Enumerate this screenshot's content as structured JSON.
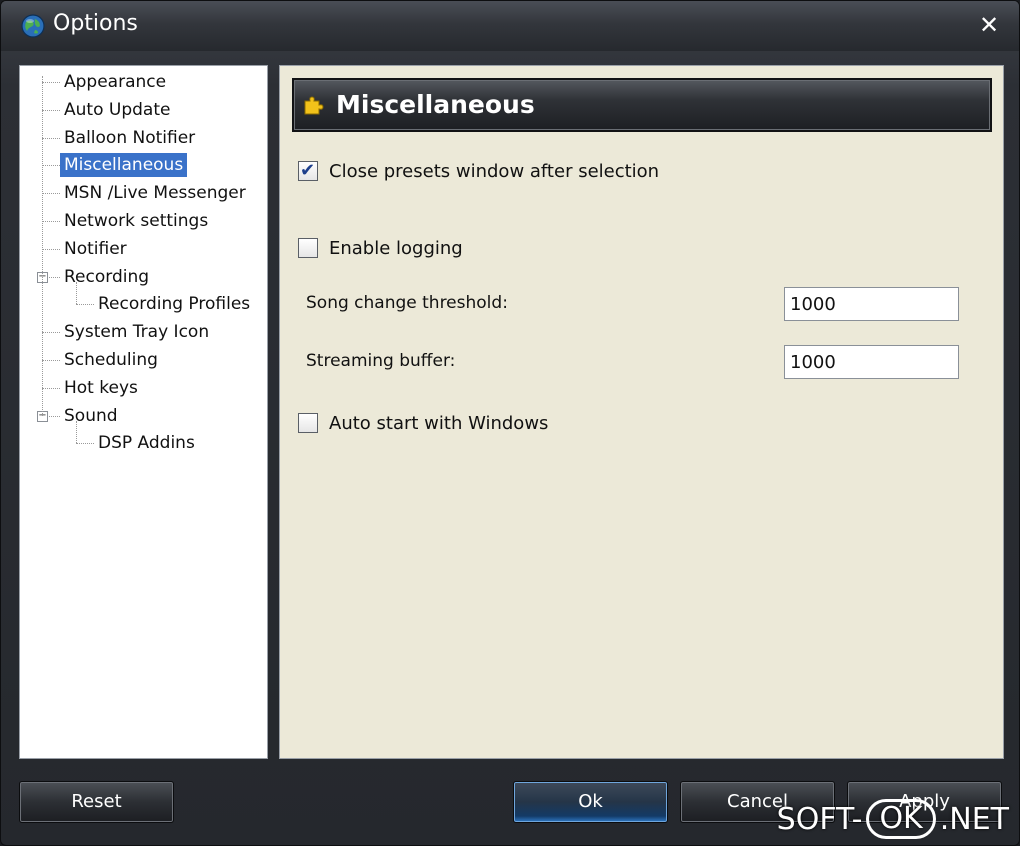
{
  "window": {
    "title": "Options",
    "close_label": "✕"
  },
  "tree": {
    "items": [
      {
        "label": "Appearance",
        "level": 0
      },
      {
        "label": "Auto Update",
        "level": 0
      },
      {
        "label": "Balloon Notifier",
        "level": 0
      },
      {
        "label": "Miscellaneous",
        "level": 0,
        "selected": true
      },
      {
        "label": "MSN /Live Messenger",
        "level": 0
      },
      {
        "label": "Network settings",
        "level": 0
      },
      {
        "label": "Notifier",
        "level": 0
      },
      {
        "label": "Recording",
        "level": 0,
        "expander": "−"
      },
      {
        "label": "Recording Profiles",
        "level": 1
      },
      {
        "label": "System Tray Icon",
        "level": 0
      },
      {
        "label": "Scheduling",
        "level": 0
      },
      {
        "label": "Hot keys",
        "level": 0
      },
      {
        "label": "Sound",
        "level": 0,
        "expander": "−"
      },
      {
        "label": "DSP Addins",
        "level": 1
      }
    ]
  },
  "content": {
    "header": {
      "title": "Miscellaneous",
      "icon": "puzzle-icon"
    },
    "close_presets": {
      "label": "Close presets window after selection",
      "checked": true
    },
    "enable_logging": {
      "label": "Enable logging",
      "checked": false
    },
    "song_change": {
      "label": "Song change threshold:",
      "value": "1000"
    },
    "streaming_buffer": {
      "label": "Streaming buffer:",
      "value": "1000"
    },
    "auto_start": {
      "label": "Auto start with Windows",
      "checked": false
    }
  },
  "buttons": {
    "reset": "Reset",
    "ok": "Ok",
    "cancel": "Cancel",
    "apply": "Apply"
  },
  "watermark": {
    "left": "SOFT-",
    "middle": "OK",
    "right": ".NET"
  },
  "colors": {
    "selection": "#3a72c9",
    "panel": "#ece9d8",
    "chrome": "#2c2f35"
  }
}
